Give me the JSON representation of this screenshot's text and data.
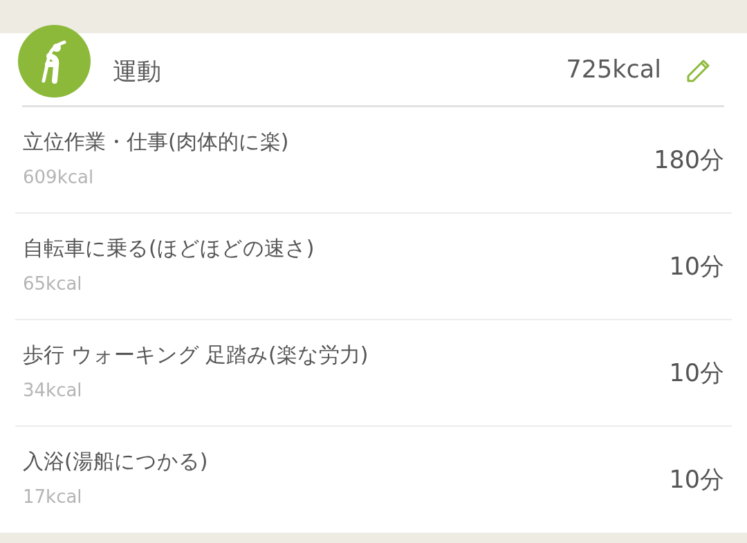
{
  "section": {
    "title": "運動",
    "total": "725kcal"
  },
  "items": [
    {
      "name": "立位作業・仕事(肉体的に楽)",
      "kcal": "609kcal",
      "duration": "180分"
    },
    {
      "name": "自転車に乗る(ほどほどの速さ)",
      "kcal": "65kcal",
      "duration": "10分"
    },
    {
      "name": "歩行 ウォーキング 足踏み(楽な労力)",
      "kcal": "34kcal",
      "duration": "10分"
    },
    {
      "name": "入浴(湯船につかる)",
      "kcal": "17kcal",
      "duration": "10分"
    }
  ]
}
